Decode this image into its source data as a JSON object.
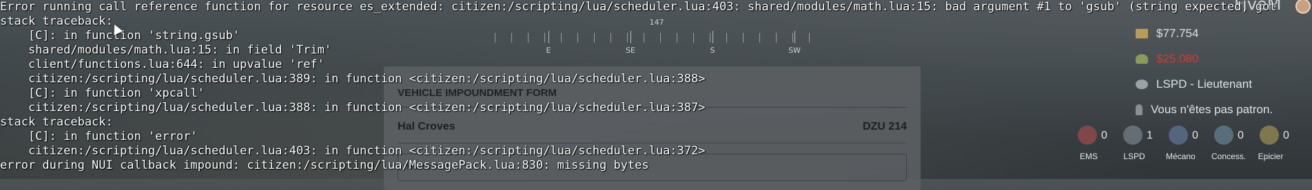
{
  "compass": {
    "heading": "147",
    "directions": [
      "E",
      "SE",
      "S",
      "SW"
    ]
  },
  "form": {
    "title": "VEHICLE IMPOUNDMENT FORM",
    "owner": "Hal Croves",
    "plate": "DZU 214",
    "input_value": "Hal Croves"
  },
  "hud": {
    "brand": "FiveM",
    "cash": "$77.754",
    "dirty_money": "$25.080",
    "job": "LSPD - Lieutenant",
    "boss": "Vous n'êtes pas patron.",
    "jobs": [
      {
        "label": "EMS",
        "count": "0",
        "icon": "medical-icon"
      },
      {
        "label": "LSPD",
        "count": "1",
        "icon": "police-icon"
      },
      {
        "label": "Mécano",
        "count": "0",
        "icon": "mechanic-icon"
      },
      {
        "label": "Concess.",
        "count": "0",
        "icon": "dealer-icon"
      },
      {
        "label": "Epicier",
        "count": "0",
        "icon": "grocer-icon"
      }
    ],
    "colors": {
      "dirty": "#d33a31",
      "cash": "#dfe2e4"
    }
  },
  "console": {
    "lines": [
      "Error running call reference function for resource es_extended: citizen:/scripting/lua/scheduler.lua:403: shared/modules/math.lua:15: bad argument #1 to 'gsub' (string expected, got",
      "stack traceback:",
      "    [C]: in function 'string.gsub'",
      "    shared/modules/math.lua:15: in field 'Trim'",
      "    client/functions.lua:644: in upvalue 'ref'",
      "    citizen:/scripting/lua/scheduler.lua:389: in function <citizen:/scripting/lua/scheduler.lua:388>",
      "    [C]: in function 'xpcall'",
      "    citizen:/scripting/lua/scheduler.lua:388: in function <citizen:/scripting/lua/scheduler.lua:387>",
      "stack traceback:",
      "    [C]: in function 'error'",
      "    citizen:/scripting/lua/scheduler.lua:403: in function <citizen:/scripting/lua/scheduler.lua:372>",
      "error during NUI callback impound: citizen:/scripting/lua/MessagePack.lua:830: missing bytes"
    ]
  }
}
